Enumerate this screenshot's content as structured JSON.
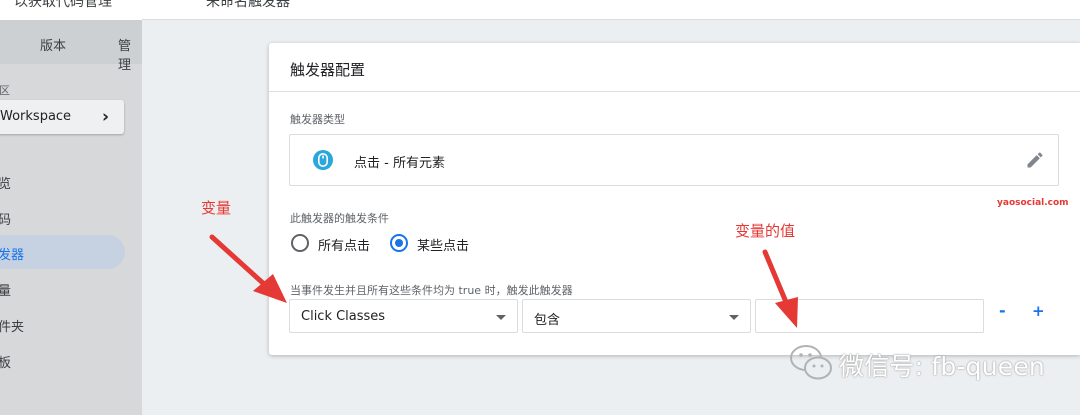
{
  "sidebar": {
    "top_label": "以获取代码管理",
    "tabs": [
      "版本",
      "管理"
    ],
    "section_label": "区",
    "workspace_label": "Workspace",
    "workspace_arrow": "›",
    "nav_items": [
      "览",
      "码",
      "发器",
      "量",
      "件夹",
      "板"
    ],
    "active_index": 2
  },
  "header": {
    "container_name": "未命名触发器"
  },
  "trigger_config": {
    "title": "触发器配置",
    "type_section_label": "触发器类型",
    "type_icon": "mouse-icon",
    "type_name": "点击 - 所有元素",
    "edit_icon": "pencil-icon",
    "condition_section_label": "此触发器的触发条件",
    "radio_options": [
      {
        "label": "所有点击",
        "selected": false
      },
      {
        "label": "某些点击",
        "selected": true
      }
    ],
    "condition_hint": "当事件发生并且所有这些条件均为 true 时，触发此触发器",
    "condition": {
      "variable": "Click Classes",
      "operator": "包含",
      "value": ""
    },
    "remove_label": "-",
    "add_label": "+"
  },
  "annotations": {
    "site": "yaosocial.com",
    "variable_label": "变量",
    "value_label": "变量的值",
    "wechat": "微信号: fb-queen"
  },
  "colors": {
    "accent": "#1a73e8",
    "annotation": "#e53935",
    "mouse_icon": "#2aa7dc"
  }
}
